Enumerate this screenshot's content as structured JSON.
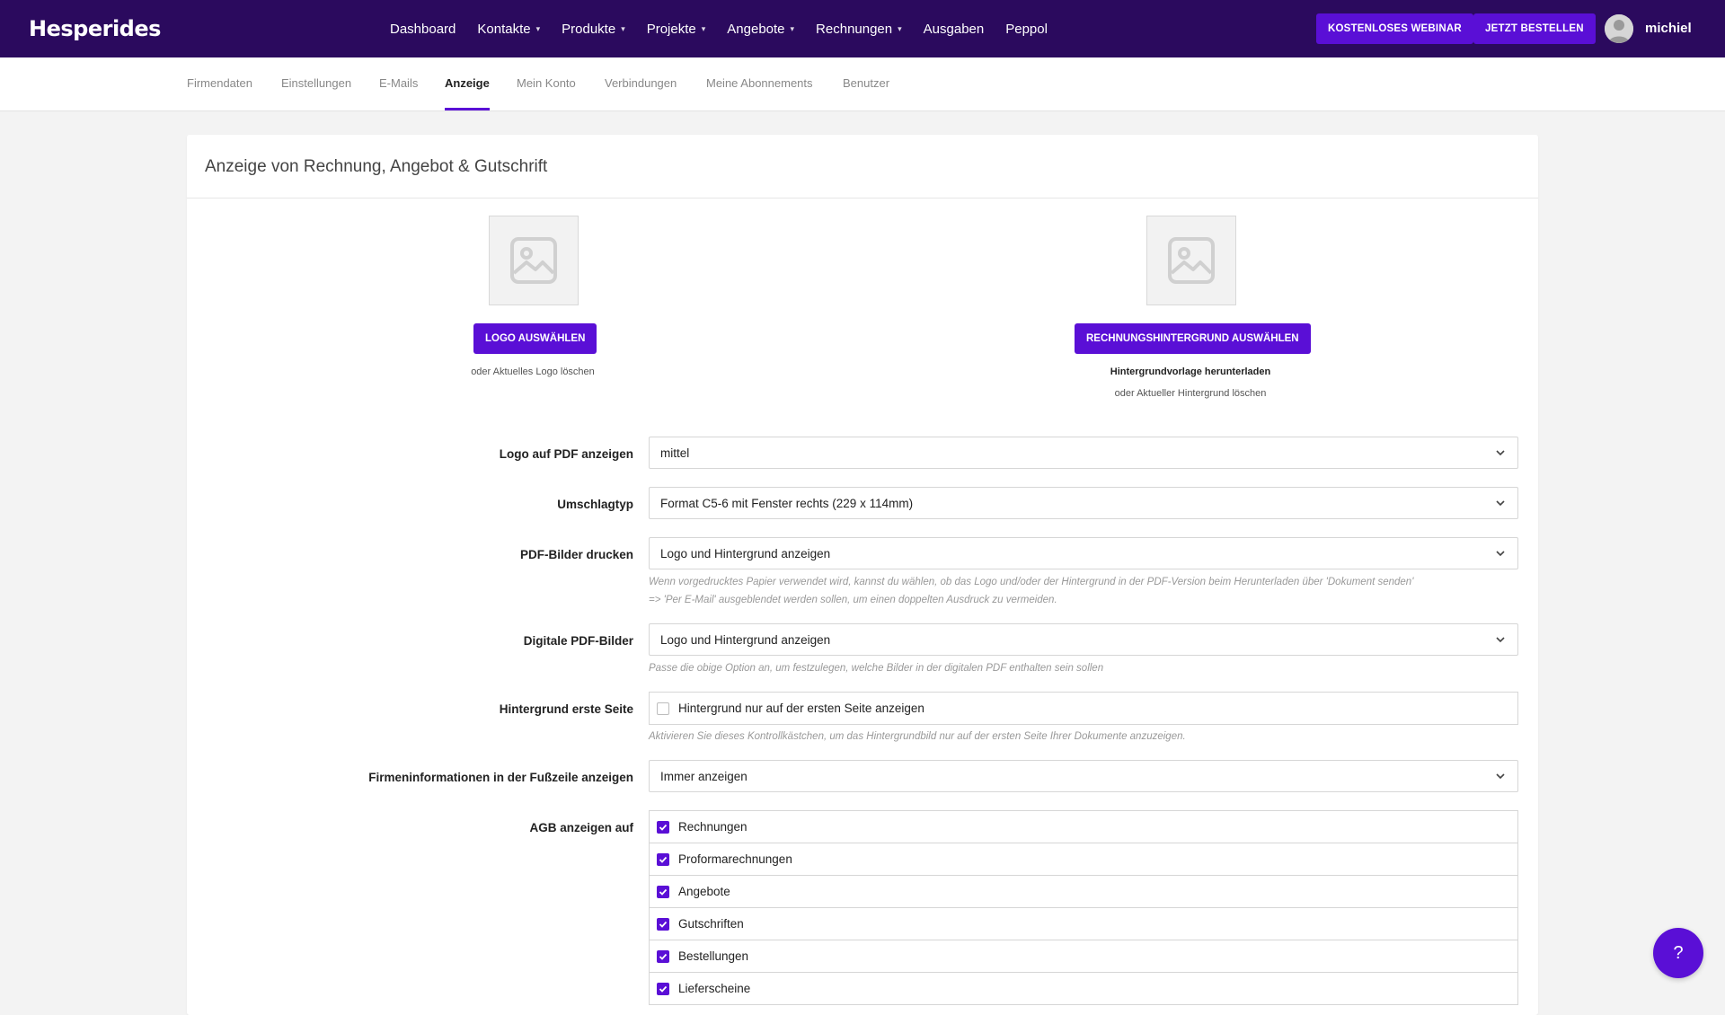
{
  "brand": "Hesperides",
  "nav": [
    {
      "label": "Dashboard",
      "dropdown": false
    },
    {
      "label": "Kontakte",
      "dropdown": true
    },
    {
      "label": "Produkte",
      "dropdown": true
    },
    {
      "label": "Projekte",
      "dropdown": true
    },
    {
      "label": "Angebote",
      "dropdown": true
    },
    {
      "label": "Rechnungen",
      "dropdown": true
    },
    {
      "label": "Ausgaben",
      "dropdown": false
    },
    {
      "label": "Peppol",
      "dropdown": false
    }
  ],
  "header_buttons": {
    "webinar": "KOSTENLOSES WEBINAR",
    "order": "JETZT BESTELLEN"
  },
  "user": {
    "name": "michiel"
  },
  "tabs": [
    "Firmendaten",
    "Einstellungen",
    "E-Mails",
    "Anzeige",
    "Mein Konto",
    "Verbindungen",
    "Meine Abonnements",
    "Benutzer"
  ],
  "active_tab": "Anzeige",
  "card": {
    "title": "Anzeige von Rechnung, Angebot & Gutschrift",
    "logo": {
      "button": "LOGO AUSWÄHLEN",
      "delete": "oder Aktuelles Logo löschen"
    },
    "background": {
      "button": "RECHNUNGSHINTERGRUND AUSWÄHLEN",
      "download": "Hintergrundvorlage herunterladen",
      "delete": "oder Aktueller Hintergrund löschen"
    }
  },
  "fields": {
    "logo_pdf": {
      "label": "Logo auf PDF anzeigen",
      "value": "mittel"
    },
    "envelope": {
      "label": "Umschlagtyp",
      "value": "Format C5-6 mit Fenster rechts (229 x 114mm)"
    },
    "pdf_print": {
      "label": "PDF-Bilder drucken",
      "value": "Logo und Hintergrund anzeigen",
      "hint_line1": "Wenn vorgedrucktes Papier verwendet wird, kannst du wählen, ob das Logo und/oder der Hintergrund in der PDF-Version beim Herunterladen über 'Dokument senden'",
      "hint_line2": "=> 'Per E-Mail' ausgeblendet werden sollen, um einen doppelten Ausdruck zu vermeiden."
    },
    "pdf_digital": {
      "label": "Digitale PDF-Bilder",
      "value": "Logo und Hintergrund anzeigen",
      "hint": "Passe die obige Option an, um festzulegen, welche Bilder in der digitalen PDF enthalten sein sollen"
    },
    "bg_first": {
      "label": "Hintergrund erste Seite",
      "checkbox": "Hintergrund nur auf der ersten Seite anzeigen",
      "checked": false,
      "hint": "Aktivieren Sie dieses Kontrollkästchen, um das Hintergrundbild nur auf der ersten Seite Ihrer Dokumente anzuzeigen."
    },
    "footer_info": {
      "label": "Firmeninformationen in der Fußzeile anzeigen",
      "value": "Immer anzeigen"
    },
    "agb": {
      "label": "AGB anzeigen auf",
      "items": [
        {
          "label": "Rechnungen",
          "checked": true
        },
        {
          "label": "Proformarechnungen",
          "checked": true
        },
        {
          "label": "Angebote",
          "checked": true
        },
        {
          "label": "Gutschriften",
          "checked": true
        },
        {
          "label": "Bestellungen",
          "checked": true
        },
        {
          "label": "Lieferscheine",
          "checked": true
        }
      ]
    }
  },
  "help_label": "?",
  "colors": {
    "topbar": "#2b0a5e",
    "accent": "#5a0fd6"
  }
}
